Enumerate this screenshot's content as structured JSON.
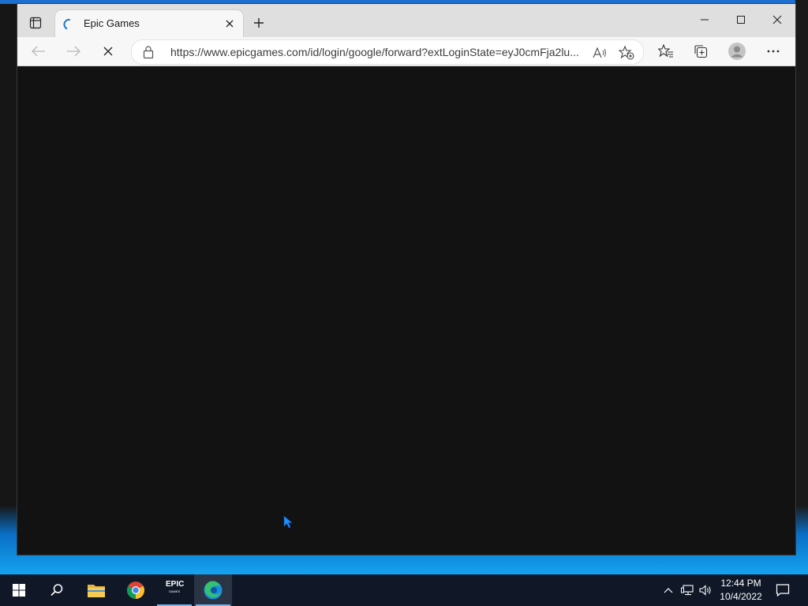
{
  "window": {
    "tab_title": "Epic Games",
    "url": "https://www.epicgames.com/id/login/google/forward?extLoginState=eyJ0cmFja2lu..."
  },
  "taskbar": {
    "epic_label": "EPIC",
    "epic_sub": "GAMES",
    "time": "12:44 PM",
    "date": "10/4/2022"
  },
  "icons": {
    "tab_actions": "tab-actions-icon",
    "loading": "loading-spinner-icon",
    "close_tab": "close-icon",
    "new_tab": "plus-icon",
    "minimize": "minimize-icon",
    "maximize": "maximize-icon",
    "close_window": "close-icon",
    "back": "back-arrow-icon",
    "forward": "forward-arrow-icon",
    "stop": "stop-loading-icon",
    "lock": "lock-icon",
    "read_aloud": "read-aloud-icon",
    "add_favorite": "add-favorite-icon",
    "favorites": "favorites-icon",
    "collections": "collections-icon",
    "profile": "profile-icon",
    "more": "more-icon"
  },
  "colors": {
    "accent": "#0078d4",
    "page_bg": "#121212",
    "taskbar_bg": "#101828"
  }
}
